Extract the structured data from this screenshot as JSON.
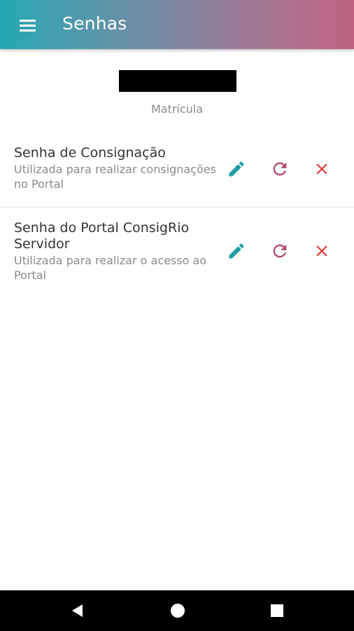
{
  "app_bar": {
    "title": "Senhas",
    "menu_icon": "hamburger-menu-icon",
    "gradient_start": "#26a9b5",
    "gradient_end": "#c16382"
  },
  "profile": {
    "matricula_label": "Matrícula"
  },
  "passwords": [
    {
      "title": "Senha de Consignação",
      "description": "Utilizada para realizar consignações no Portal",
      "actions": [
        "edit-icon",
        "refresh-icon",
        "close-icon"
      ]
    },
    {
      "title": "Senha do Portal ConsigRio Servidor",
      "description": "Utilizada para realizar o acesso ao Portal",
      "actions": [
        "edit-icon",
        "refresh-icon",
        "close-icon"
      ]
    }
  ],
  "colors": {
    "edit": "#1f9ea6",
    "refresh": "#b34a6f",
    "delete": "#e53935"
  },
  "nav_bar": {
    "buttons": [
      "back-icon",
      "home-icon",
      "recents-icon"
    ]
  }
}
